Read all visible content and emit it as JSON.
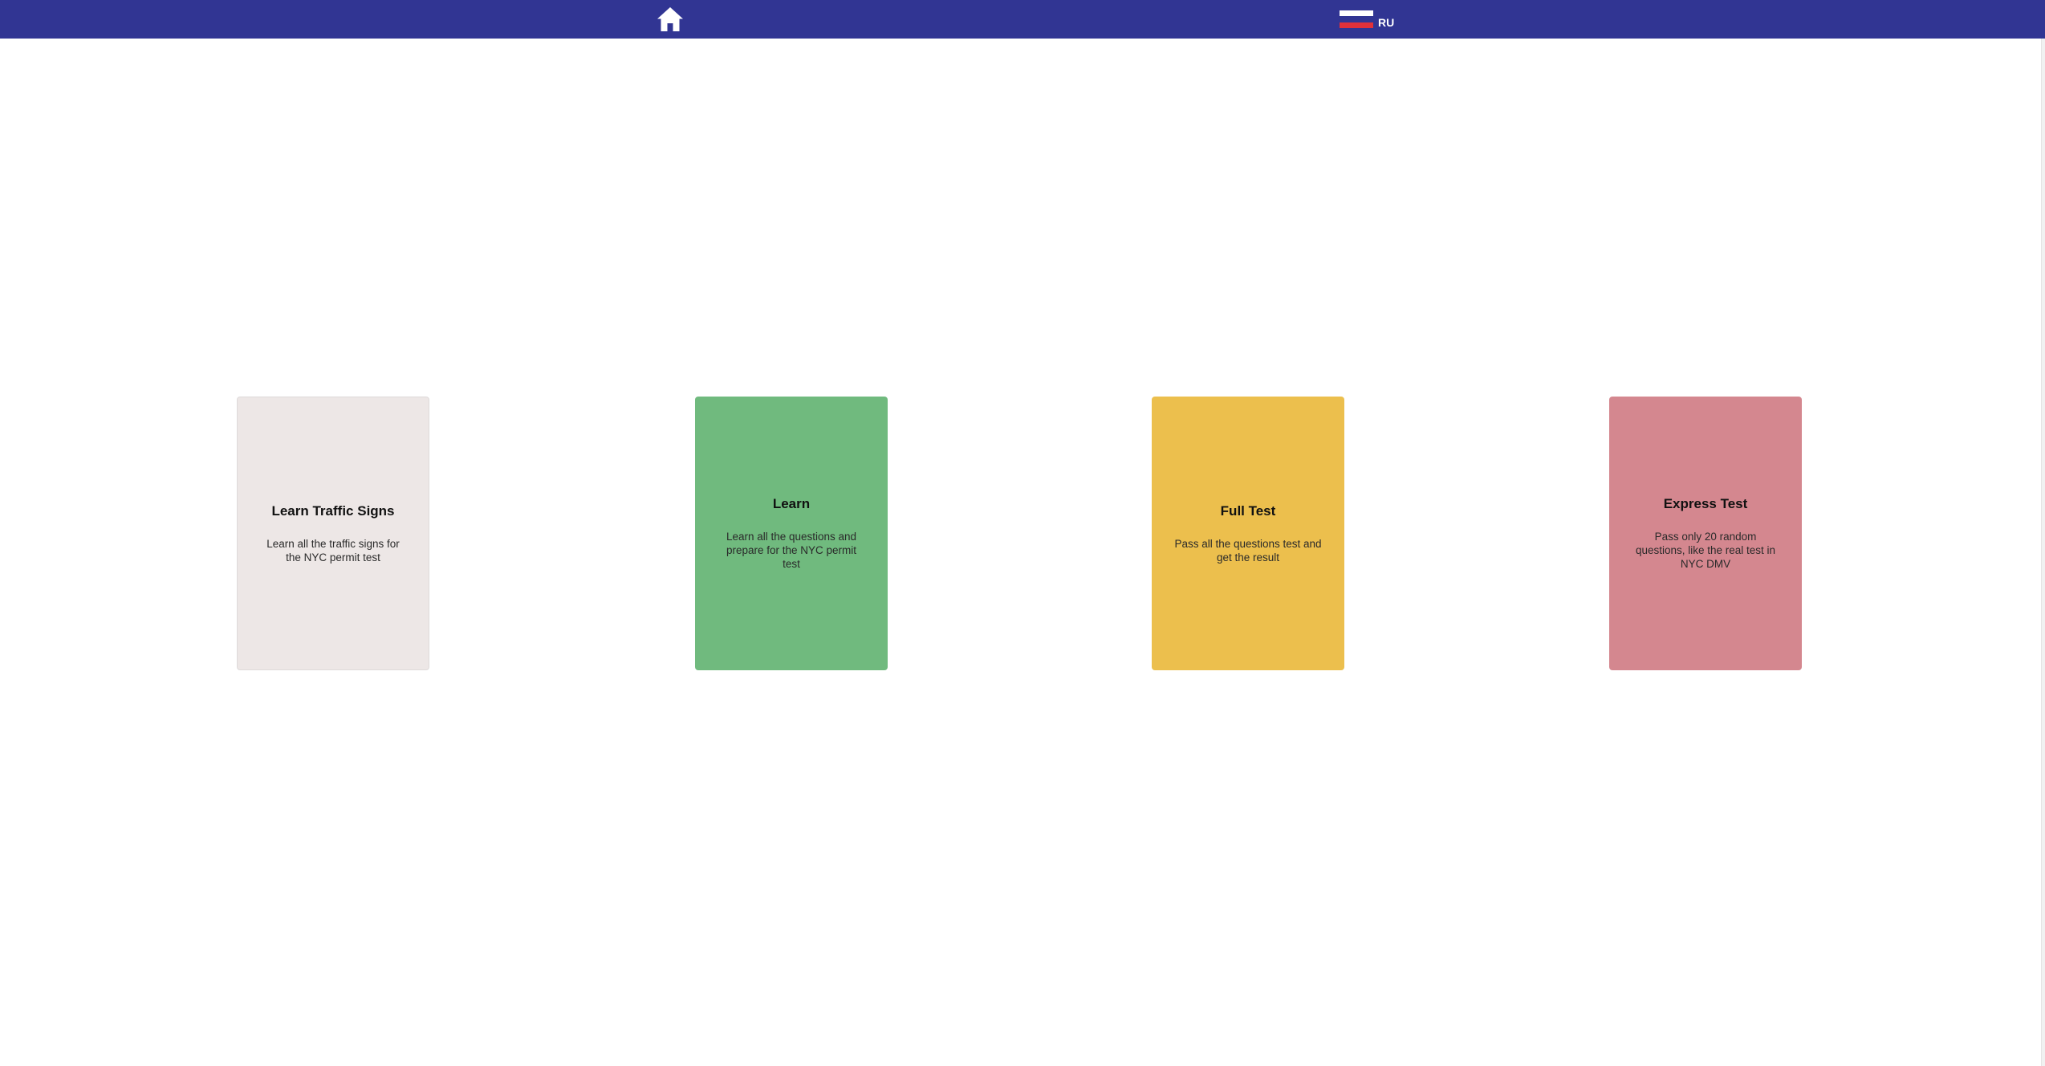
{
  "header": {
    "home_icon": "home-icon",
    "language": {
      "label": "RU",
      "flag_icon": "russia-flag-icon",
      "flag_colors": [
        "#ffffff",
        "#313593",
        "#e0313a"
      ]
    }
  },
  "cards": [
    {
      "title": "Learn Traffic Signs",
      "description": "Learn all the traffic signs for the NYC permit test",
      "color": "#ede7e6"
    },
    {
      "title": "Learn",
      "description": "Learn all the questions and prepare for the NYC permit test",
      "color": "#70ba7e"
    },
    {
      "title": "Full Test",
      "description": "Pass all the questions test and get the result",
      "color": "#ecbf4d"
    },
    {
      "title": "Express Test",
      "description": "Pass only 20 random questions, like the real test in NYC DMV",
      "color": "#d4878f"
    }
  ],
  "colors": {
    "header_bg": "#313593",
    "page_bg": "#ffffff"
  }
}
